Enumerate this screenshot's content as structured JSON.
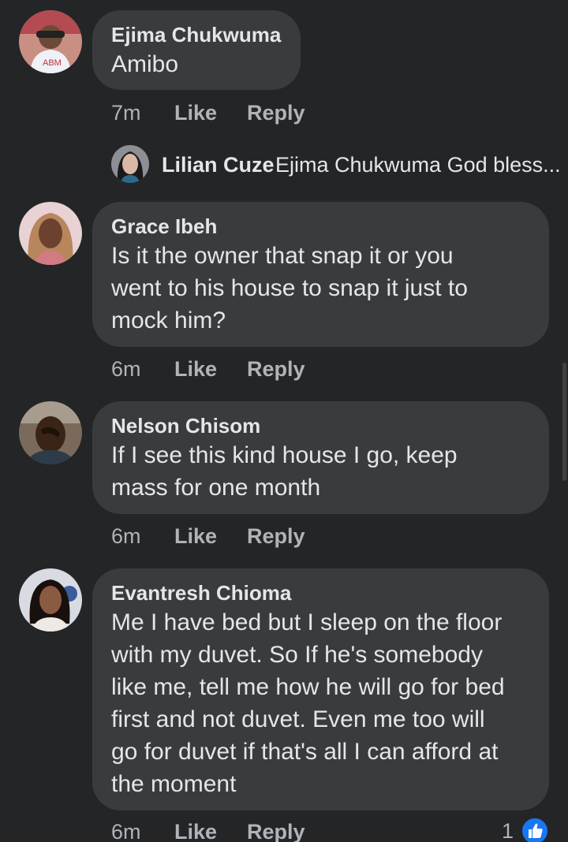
{
  "colors": {
    "background": "#242526",
    "bubble": "#3a3b3c",
    "primary_text": "#e4e6eb",
    "secondary_text": "#b0b3b8",
    "like_blue": "#1877f2"
  },
  "comments": [
    {
      "author": "Ejima Chukwuma",
      "text": "Amibo",
      "time": "7m",
      "like_label": "Like",
      "reply_label": "Reply"
    },
    {
      "author": "Grace Ibeh",
      "text": "Is it the owner that snap it or you\nwent to his house to snap it just to\nmock him?",
      "time": "6m",
      "like_label": "Like",
      "reply_label": "Reply"
    },
    {
      "author": "Nelson Chisom",
      "text": "If I see this kind house I go, keep\nmass for one month",
      "time": "6m",
      "like_label": "Like",
      "reply_label": "Reply"
    },
    {
      "author": "Evantresh Chioma",
      "text": "Me I have bed but I sleep on the floor\nwith my duvet. So If he's somebody\nlike me, tell me how he will go for bed\nfirst and not duvet. Even me too will\ngo for duvet if that's all I can afford at\nthe moment",
      "time": "6m",
      "like_label": "Like",
      "reply_label": "Reply",
      "reaction_count": "1",
      "reaction_icon": "thumbs-up-icon"
    }
  ],
  "reply_preview": {
    "author": "Lilian Cuze",
    "text": "Ejima Chukwuma God bless..."
  }
}
